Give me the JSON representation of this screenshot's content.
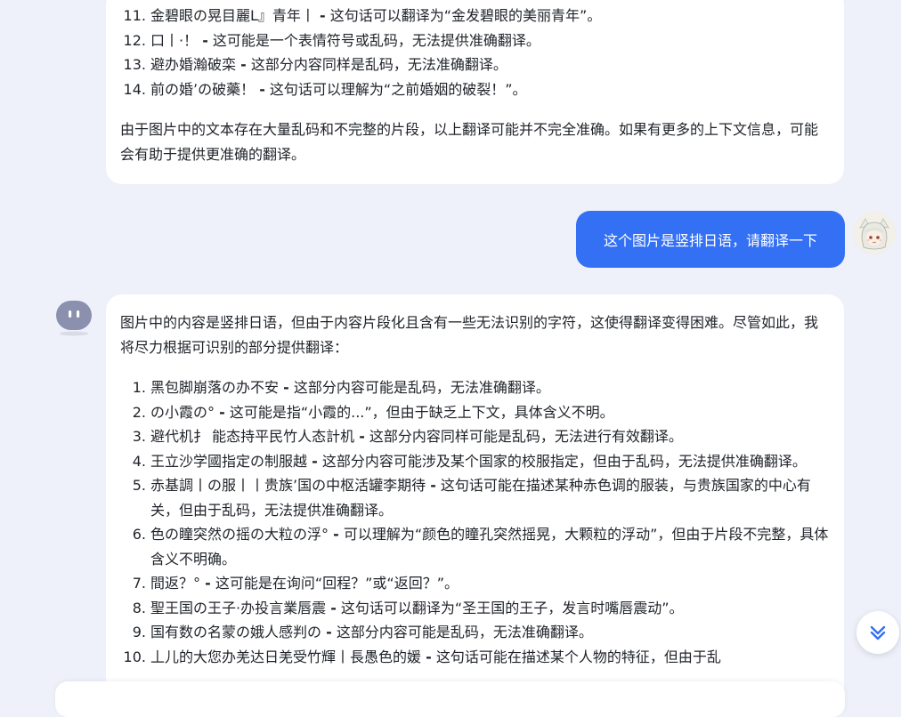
{
  "chat": {
    "ai_message_1": {
      "items": [
        {
          "num": "11.",
          "pre": "金碧眼の晃目麗L』青年丨",
          "post": "这句话可以翻译为“金发碧眼的美丽青年”。"
        },
        {
          "num": "12.",
          "pre": "口丨·！",
          "post": "这可能是一个表情符号或乱码，无法提供准确翻译。"
        },
        {
          "num": "13.",
          "pre": "避办婚瀚破栾",
          "post": "这部分内容同样是乱码，无法准确翻译。"
        },
        {
          "num": "14.",
          "pre": "前の婚’の破藥！",
          "post": "这句话可以理解为“之前婚姻的破裂！”。"
        }
      ],
      "summary": "由于图片中的文本存在大量乱码和不完整的片段，以上翻译可能并不完全准确。如果有更多的上下文信息，可能会有助于提供更准确的翻译。"
    },
    "user_message": "这个图片是竖排日语，请翻译一下",
    "ai_message_2": {
      "intro": "图片中的内容是竖排日语，但由于内容片段化且含有一些无法识别的字符，这使得翻译变得困难。尽管如此，我将尽力根据可识别的部分提供翻译：",
      "items": [
        {
          "num": "1.",
          "pre": "黑包脚崩落の办不安",
          "post": "这部分内容可能是乱码，无法准确翻译。"
        },
        {
          "num": "2.",
          "pre": "の小霞の°",
          "post": "这可能是指“小霞的...”，但由于缺乏上下文，具体含义不明。"
        },
        {
          "num": "3.",
          "pre": "避代机扌 能态持平民竹人态計机",
          "post": "这部分内容同样可能是乱码，无法进行有效翻译。"
        },
        {
          "num": "4.",
          "pre": "王立沙学國指定の制服越",
          "post": "这部分内容可能涉及某个国家的校服指定，但由于乱码，无法提供准确翻译。"
        },
        {
          "num": "5.",
          "pre": "赤基調丨の服丨丨贵族’国の中枢活罐李期待",
          "post": "这句话可能在描述某种赤色调的服装，与贵族国家的中心有关，但由于乱码，无法提供准确翻译。"
        },
        {
          "num": "6.",
          "pre": "色の瞳突然の摇の大粒の浮°",
          "post": "可以理解为“颜色的瞳孔突然摇晃，大颗粒的浮动”，但由于片段不完整，具体含义不明确。"
        },
        {
          "num": "7.",
          "pre": "間返？°",
          "post": "这可能是在询问“回程？”或“返回？”。"
        },
        {
          "num": "8.",
          "pre": "聖王国の王子·办投言業唇震",
          "post": "这句话可以翻译为“圣王国的王子，发言时嘴唇震动”。"
        },
        {
          "num": "9.",
          "pre": "国有数の名蒙の娥人感判の",
          "post": "这部分内容可能是乱码，无法准确翻译。"
        },
        {
          "num": "10.",
          "pre": "丄儿的大您办羌达日羌受竹輝丨長愚色的媛",
          "post": "这句话可能在描述某个人物的特征，但由于乱"
        }
      ]
    }
  },
  "icons": {
    "scroll_down": "double-chevron-down-icon",
    "bot": "bot-avatar-icon",
    "user": "user-avatar"
  },
  "colors": {
    "page_bg": "#eef1fa",
    "user_bubble": "#3470f4",
    "accent": "#3470f4"
  }
}
